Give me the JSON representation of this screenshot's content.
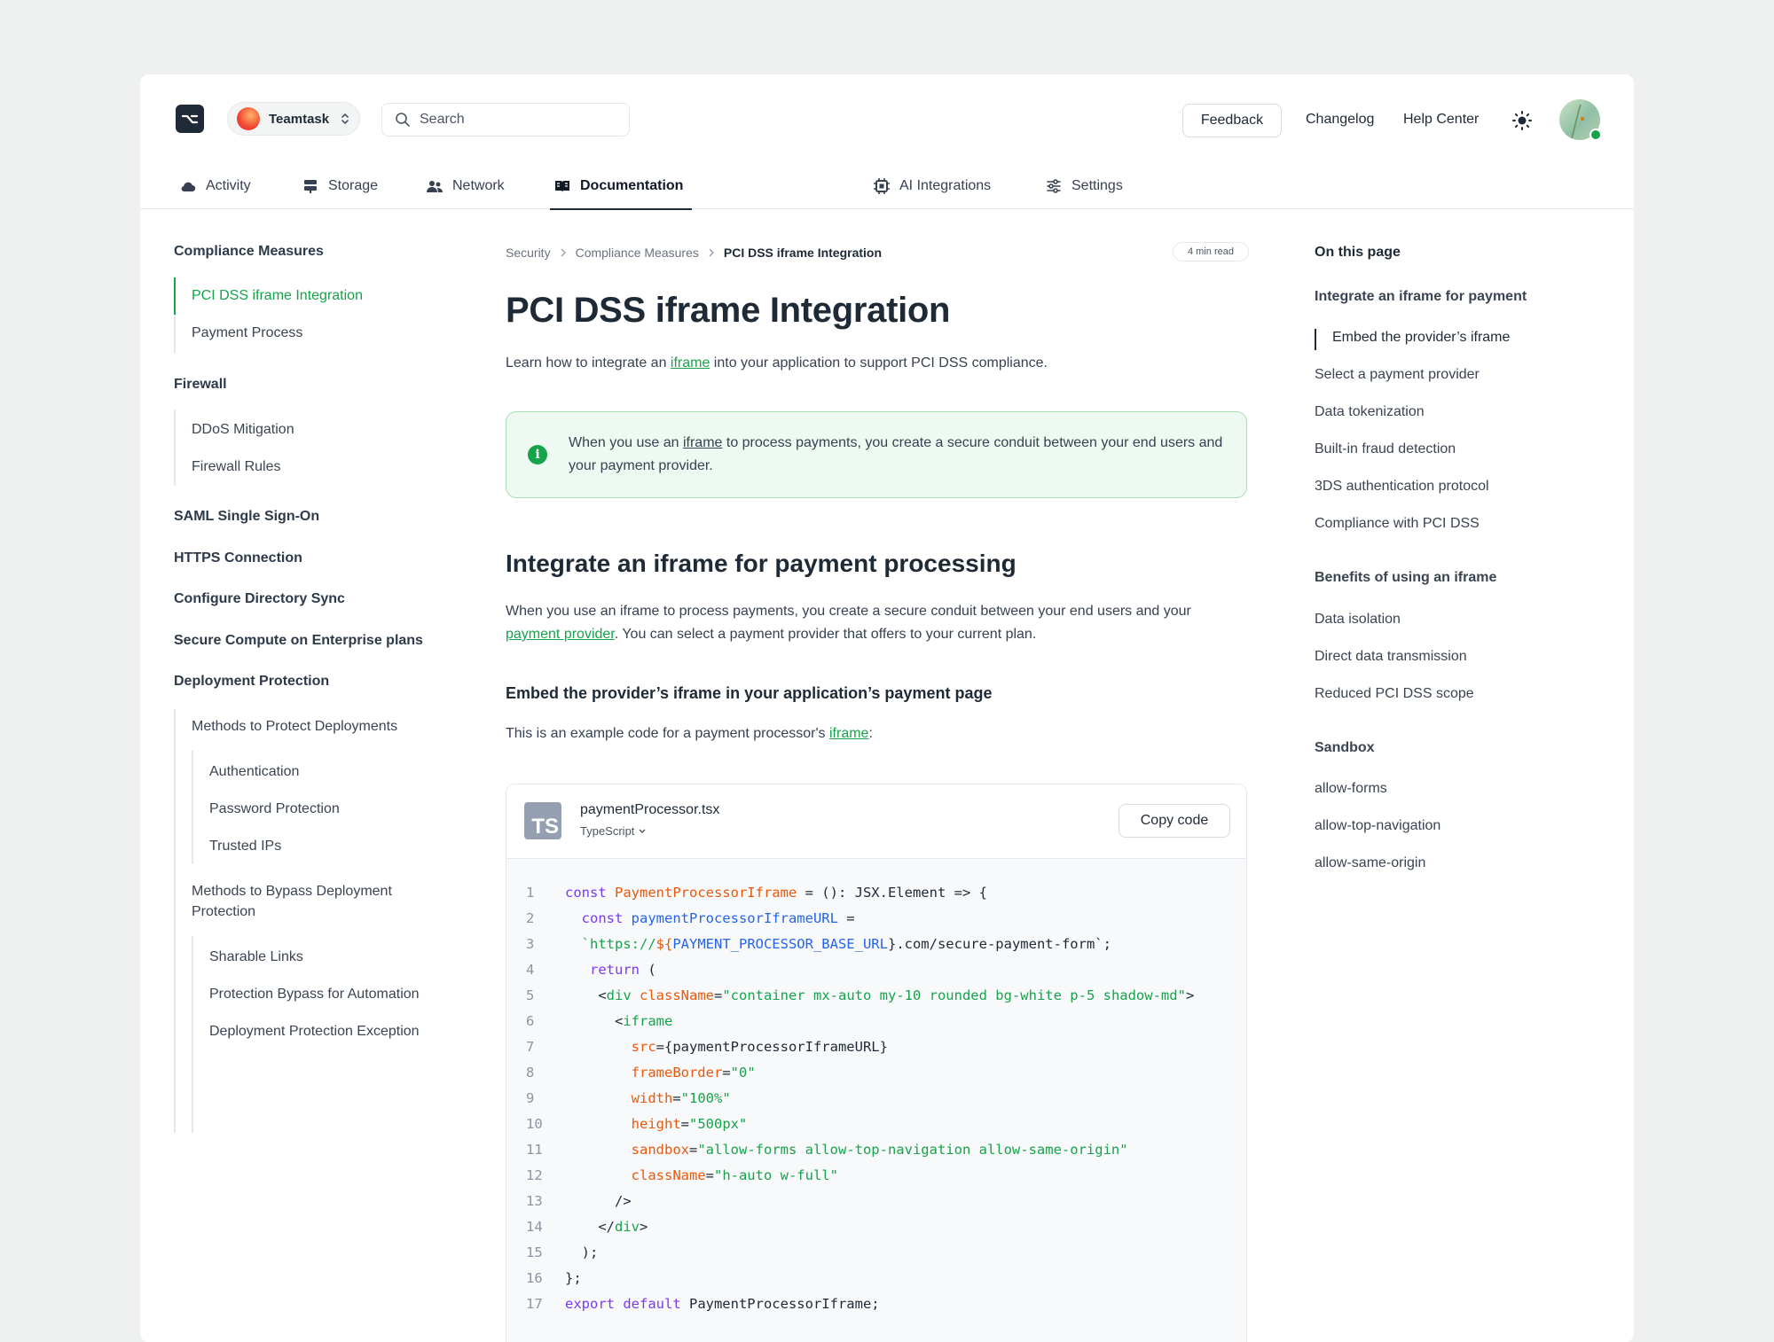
{
  "header": {
    "team_name": "Teamtask",
    "search_placeholder": "Search",
    "feedback": "Feedback",
    "changelog": "Changelog",
    "help_center": "Help Center"
  },
  "tabs": [
    {
      "label": "Activity",
      "icon": "cloud-icon"
    },
    {
      "label": "Storage",
      "icon": "storage-icon"
    },
    {
      "label": "Network",
      "icon": "users-icon"
    },
    {
      "label": "Documentation",
      "icon": "book-icon",
      "active": true
    },
    {
      "label": "AI Integrations",
      "icon": "chip-icon"
    },
    {
      "label": "Settings",
      "icon": "sliders-icon"
    }
  ],
  "sidebar": {
    "compliance": "Compliance Measures",
    "pci": "PCI DSS iframe Integration",
    "payment_process": "Payment Process",
    "firewall": "Firewall",
    "ddos": "DDoS Mitigation",
    "firewall_rules": "Firewall Rules",
    "saml": "SAML Single Sign-On",
    "https": "HTTPS Connection",
    "directory_sync": "Configure Directory Sync",
    "secure_compute": "Secure Compute on Enterprise plans",
    "deployment_protection": "Deployment Protection",
    "methods_protect": "Methods to Protect Deployments",
    "authentication": "Authentication",
    "password_protection": "Password Protection",
    "trusted_ips": "Trusted IPs",
    "methods_bypass_1": "Methods to Bypass Deployment",
    "methods_bypass_2": "Protection",
    "sharable_links": "Sharable Links",
    "bypass_automation": "Protection Bypass for Automation",
    "protection_exception": "Deployment Protection Exception"
  },
  "breadcrumb": {
    "items": [
      "Security",
      "Compliance Measures"
    ],
    "current": "PCI DSS iframe Integration",
    "read_time": "4 min read"
  },
  "article": {
    "title": "PCI DSS iframe Integration",
    "intro_before": "Learn how to integrate an ",
    "intro_link": "iframe",
    "intro_after": " into your application to support PCI DSS compliance.",
    "callout_before": "When you use an ",
    "callout_link": "iframe",
    "callout_after": " to process payments, you create a secure conduit between your end users and your payment provider.",
    "h2": "Integrate an iframe for payment processing",
    "para2_before": "When you use an iframe to process payments, you create a secure conduit between your end users and your ",
    "para2_link": "payment provider",
    "para2_after": ". You can select a payment provider that offers to your current plan.",
    "h3": "Embed the provider’s iframe in your application’s payment page",
    "para3_before": "This is an example code for a payment processor's ",
    "para3_link": "iframe",
    "para3_after": ":"
  },
  "code": {
    "filename": "paymentProcessor.tsx",
    "language": "TypeScript",
    "copy_label": "Copy code",
    "badge": "TS",
    "lines": [
      [
        [
          "const ",
          "#7c3aed"
        ],
        [
          "PaymentProcessorIframe",
          "#ea580c"
        ],
        [
          " = (): JSX.Element => {",
          "#1f2a37"
        ]
      ],
      [
        [
          "  const ",
          "#7c3aed"
        ],
        [
          "paymentProcessorIframeURL",
          "#2563eb"
        ],
        [
          " =",
          "#1f2a37"
        ]
      ],
      [
        [
          "  `https://",
          "#16a34a"
        ],
        [
          "${",
          "#ea580c"
        ],
        [
          "PAYMENT_PROCESSOR_BASE_URL",
          "#2563eb"
        ],
        [
          "}",
          "#1f2a37"
        ],
        [
          ".com/secure-payment-form`",
          "#1f2a37"
        ],
        [
          ";",
          "#1f2a37"
        ]
      ],
      [
        [
          "   return ",
          "#7c3aed"
        ],
        [
          "(",
          "#1f2a37"
        ]
      ],
      [
        [
          "    <",
          "#1f2a37"
        ],
        [
          "div ",
          "#16a34a"
        ],
        [
          "className",
          "#ea580c"
        ],
        [
          "=",
          "#1f2a37"
        ],
        [
          "\"container mx-auto my-10 rounded bg-white p-5 shadow-md\"",
          "#16a34a"
        ],
        [
          ">",
          "#1f2a37"
        ]
      ],
      [
        [
          "      <",
          "#1f2a37"
        ],
        [
          "iframe",
          "#16a34a"
        ]
      ],
      [
        [
          "        src",
          "#ea580c"
        ],
        [
          "={paymentProcessorIframeURL}",
          "#1f2a37"
        ]
      ],
      [
        [
          "        frameBorder",
          "#ea580c"
        ],
        [
          "=",
          "#1f2a37"
        ],
        [
          "\"0\"",
          "#16a34a"
        ]
      ],
      [
        [
          "        width",
          "#ea580c"
        ],
        [
          "=",
          "#1f2a37"
        ],
        [
          "\"100%\"",
          "#16a34a"
        ]
      ],
      [
        [
          "        height",
          "#ea580c"
        ],
        [
          "=",
          "#1f2a37"
        ],
        [
          "\"500px\"",
          "#16a34a"
        ]
      ],
      [
        [
          "        sandbox",
          "#ea580c"
        ],
        [
          "=",
          "#1f2a37"
        ],
        [
          "\"allow-forms allow-top-navigation allow-same-origin\"",
          "#16a34a"
        ]
      ],
      [
        [
          "        className",
          "#ea580c"
        ],
        [
          "=",
          "#1f2a37"
        ],
        [
          "\"h-auto w-full\"",
          "#16a34a"
        ]
      ],
      [
        [
          "      />",
          "#1f2a37"
        ]
      ],
      [
        [
          "    </",
          "#1f2a37"
        ],
        [
          "div",
          "#16a34a"
        ],
        [
          ">",
          "#1f2a37"
        ]
      ],
      [
        [
          "  );",
          "#1f2a37"
        ]
      ],
      [
        [
          "};",
          "#1f2a37"
        ]
      ],
      [
        [
          "export default ",
          "#7c3aed"
        ],
        [
          "PaymentProcessorIframe;",
          "#1f2a37"
        ]
      ]
    ]
  },
  "toc": {
    "heading": "On this page",
    "sec1": "Integrate an iframe for payment",
    "embed": "Embed the provider’s iframe",
    "select_provider": "Select a payment provider",
    "tokenization": "Data tokenization",
    "fraud": "Built-in fraud detection",
    "3ds": "3DS authentication protocol",
    "compliance_pci": "Compliance with PCI DSS",
    "sec2": "Benefits of using an iframe",
    "isolation": "Data isolation",
    "direct": "Direct data transmission",
    "reduced": "Reduced PCI DSS scope",
    "sec3": "Sandbox",
    "allow_forms": "allow-forms",
    "allow_top": "allow-top-navigation",
    "allow_same": "allow-same-origin"
  }
}
